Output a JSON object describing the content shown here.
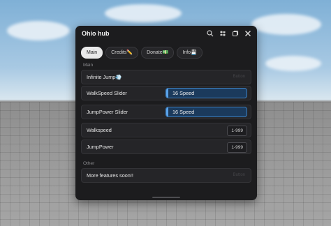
{
  "window": {
    "title": "Ohio hub"
  },
  "titlebar_icons": [
    "search-icon",
    "settings-icon",
    "minimize-icon",
    "close-icon"
  ],
  "tabs": [
    {
      "label": "Main",
      "active": true
    },
    {
      "label": "Credits✏️",
      "active": false
    },
    {
      "label": "Donate💵",
      "active": false
    },
    {
      "label": "Info💾",
      "active": false
    }
  ],
  "sections": {
    "main": "Main",
    "other": "Other"
  },
  "rows": {
    "infinite_jump": {
      "label": "Infinite Jump💨",
      "hint": "Button"
    },
    "walkspeed_slider": {
      "label": "WalkSpeed Slider",
      "value": "16 Speed"
    },
    "jumppower_slider": {
      "label": "JumpPower Slider",
      "value": "16 Speed"
    },
    "walkspeed": {
      "label": "Walkspeed",
      "input": "1-999"
    },
    "jumppower": {
      "label": "JumpPower",
      "input": "1-999"
    },
    "more_features": {
      "label": "More features soon!!",
      "hint": "Button"
    }
  },
  "colors": {
    "accent": "#3d7fc0",
    "window_bg": "#1c1c1e",
    "row_bg": "#252528"
  }
}
